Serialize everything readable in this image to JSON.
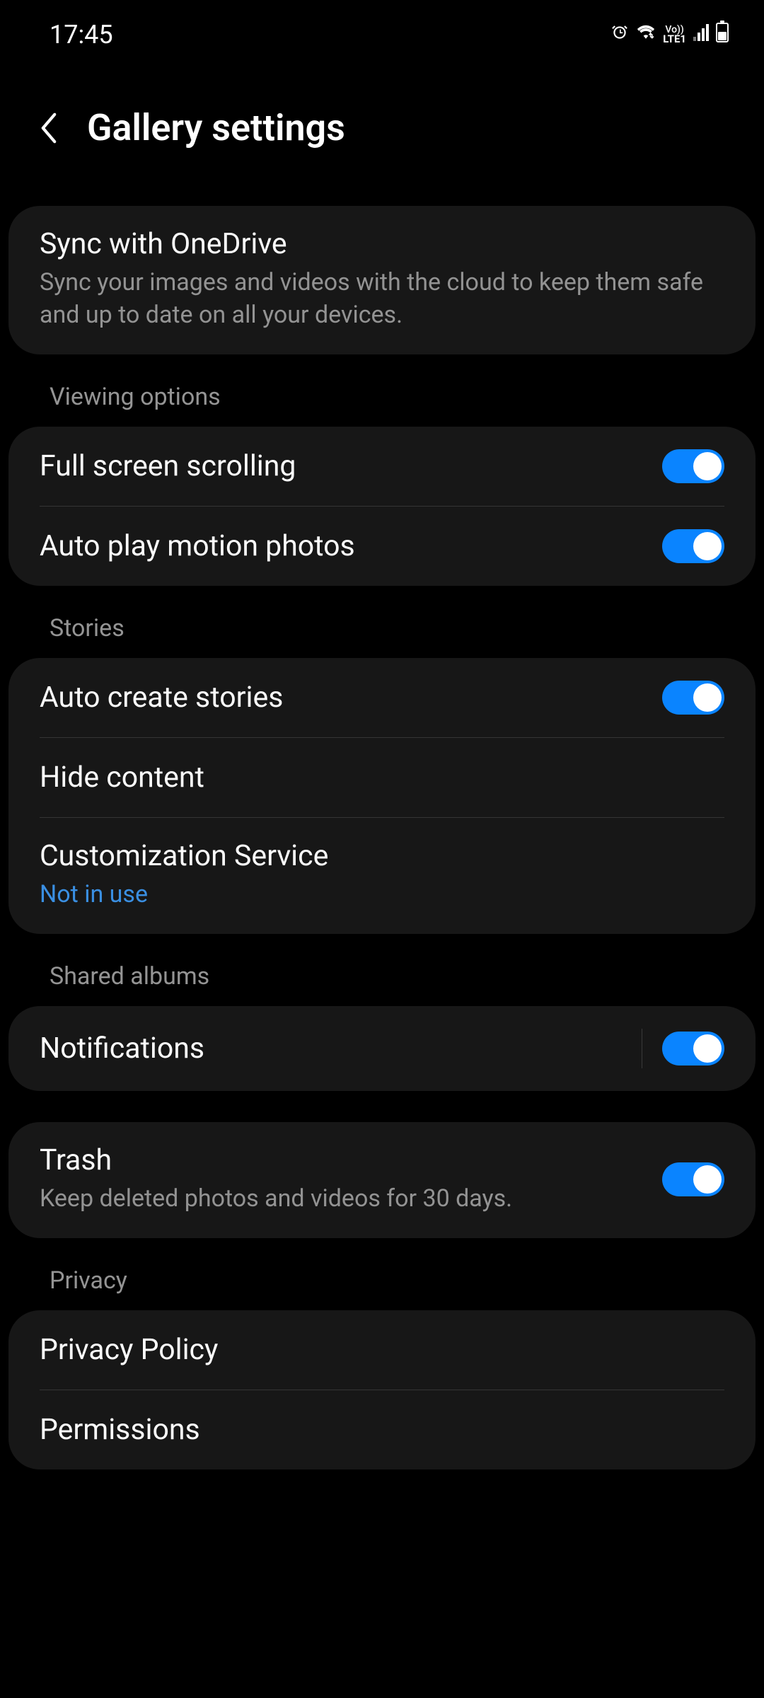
{
  "statusBar": {
    "time": "17:45",
    "lte": "LTE1",
    "vo": "Vo))"
  },
  "header": {
    "title": "Gallery settings"
  },
  "sync": {
    "title": "Sync with OneDrive",
    "subtitle": "Sync your images and videos with the cloud to keep them safe and up to date on all your devices."
  },
  "sections": {
    "viewing": "Viewing options",
    "stories": "Stories",
    "shared": "Shared albums",
    "privacy": "Privacy"
  },
  "items": {
    "fullScreen": "Full screen scrolling",
    "autoPlay": "Auto play motion photos",
    "autoCreate": "Auto create stories",
    "hideContent": "Hide content",
    "customization": "Customization Service",
    "customizationStatus": "Not in use",
    "notifications": "Notifications",
    "trash": "Trash",
    "trashSubtitle": "Keep deleted photos and videos for 30 days.",
    "privacyPolicy": "Privacy Policy",
    "permissions": "Permissions"
  },
  "toggles": {
    "fullScreen": true,
    "autoPlay": true,
    "autoCreate": true,
    "notifications": true,
    "trash": true
  }
}
